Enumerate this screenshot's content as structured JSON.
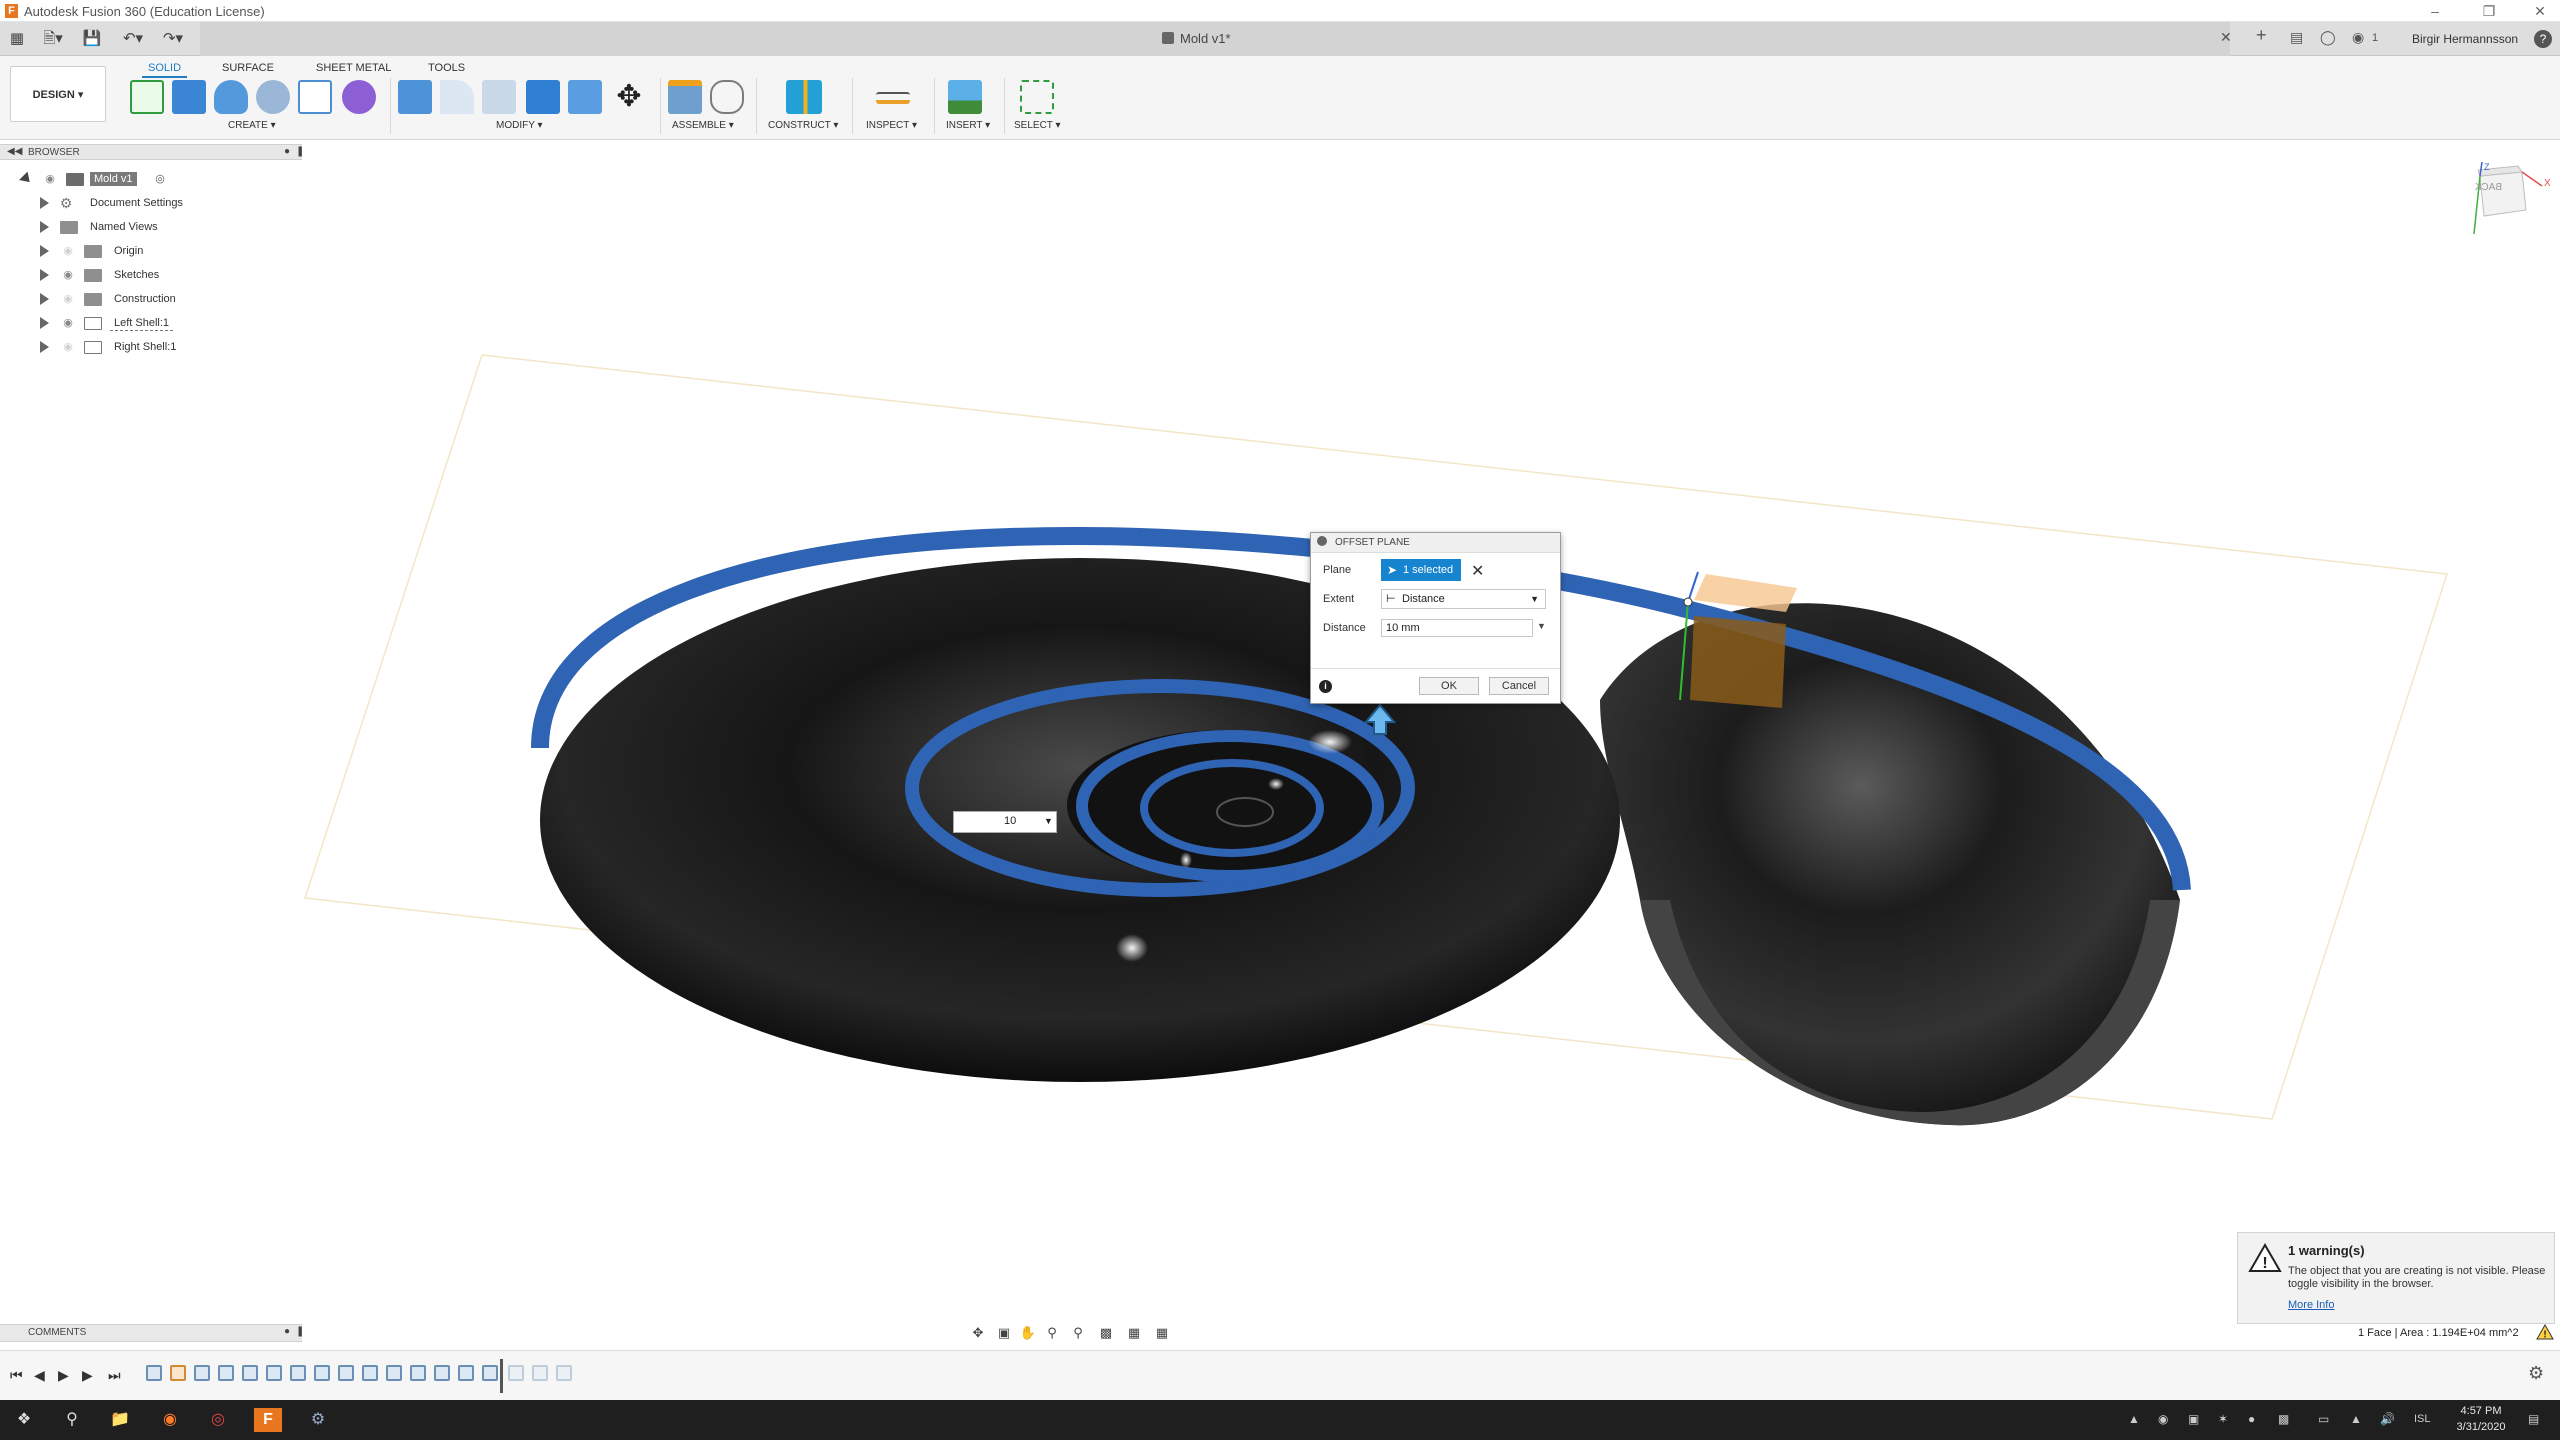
{
  "window": {
    "title": "Autodesk Fusion 360 (Education License)"
  },
  "document": {
    "tab_name": "Mold v1*"
  },
  "user": {
    "name": "Birgir Hermannsson",
    "notifications": "1"
  },
  "ribbon": {
    "workspace": "DESIGN",
    "tabs": [
      "SOLID",
      "SURFACE",
      "SHEET METAL",
      "TOOLS"
    ],
    "active_tab": "SOLID",
    "groups": [
      "CREATE",
      "MODIFY",
      "ASSEMBLE",
      "CONSTRUCT",
      "INSPECT",
      "INSERT",
      "SELECT"
    ]
  },
  "browser": {
    "title": "BROWSER",
    "root": "Mold v1",
    "items": [
      {
        "label": "Document Settings",
        "icon": "gear-icon"
      },
      {
        "label": "Named Views",
        "icon": "folder-icon"
      },
      {
        "label": "Origin",
        "icon": "folder-icon"
      },
      {
        "label": "Sketches",
        "icon": "folder-icon"
      },
      {
        "label": "Construction",
        "icon": "folder-icon"
      },
      {
        "label": "Left Shell:1",
        "icon": "component-icon"
      },
      {
        "label": "Right Shell:1",
        "icon": "component-icon"
      }
    ]
  },
  "dialog": {
    "title": "OFFSET PLANE",
    "plane_label": "Plane",
    "plane_value": "1 selected",
    "extent_label": "Extent",
    "extent_value": "Distance",
    "distance_label": "Distance",
    "distance_value": "10 mm",
    "ok": "OK",
    "cancel": "Cancel"
  },
  "canvas_input": {
    "value": "10"
  },
  "warning": {
    "title": "1 warning(s)",
    "body": "The object that you are creating is not visible. Please toggle visibility in the browser.",
    "link": "More Info"
  },
  "comments": {
    "title": "COMMENTS"
  },
  "status": {
    "text": "1 Face | Area : 1.194E+04 mm^2"
  },
  "viewcube": {
    "face": "BACK"
  },
  "taskbar": {
    "time": "4:57 PM",
    "date": "3/31/2020",
    "language": "ISL"
  },
  "colors": {
    "accent": "#1784cf",
    "shell_edge": "#2f63b3",
    "shell_body": "#151515"
  }
}
